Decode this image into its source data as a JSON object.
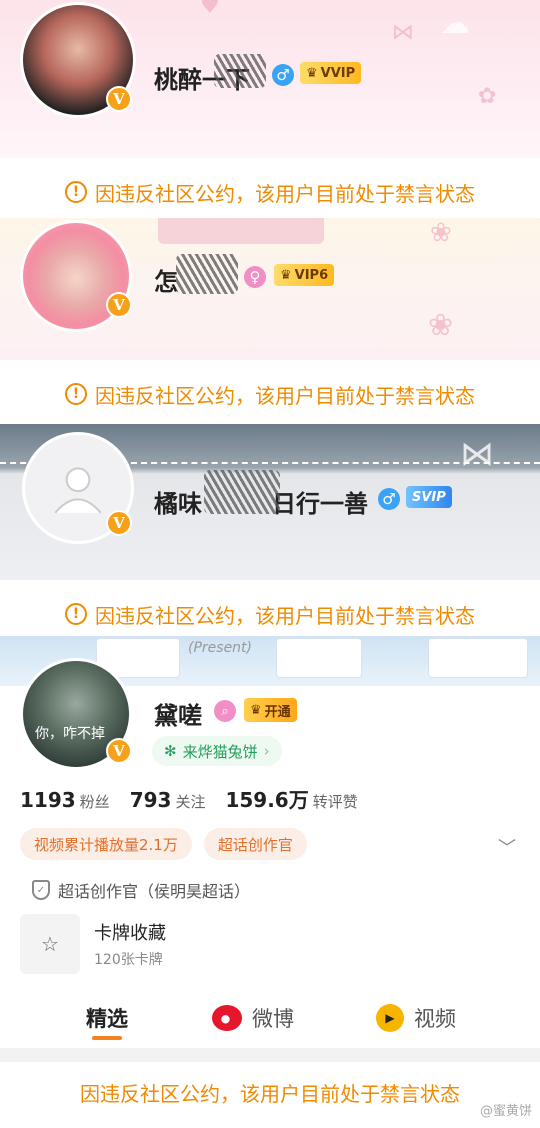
{
  "profiles": [
    {
      "name_visible": "桃醉一下",
      "gender_icon": "male-icon",
      "vip_label": "VVIP",
      "verified_badge": "V",
      "banned_notice": "因违反社区公约，该用户目前处于禁言状态"
    },
    {
      "name_visible": "怎",
      "gender_icon": "female-icon",
      "vip_label": "VIP6",
      "verified_badge": "V",
      "banned_notice": "因违反社区公约，该用户目前处于禁言状态"
    },
    {
      "name_visible": "橘味",
      "name_visible_suffix": "日行一善",
      "gender_icon": "male-icon",
      "vip_label": "SVIP",
      "verified_badge": "V",
      "banned_notice": "因违反社区公约，该用户目前处于禁言状态"
    }
  ],
  "main_profile": {
    "banner_text": "(Present)",
    "avatar_caption": "你，咋不掉",
    "name": "黛嗟",
    "verified_badge": "V",
    "open_label": "开通",
    "sponsor_label": "来烨猫兔饼",
    "stats": [
      {
        "value": "1193",
        "label": "粉丝"
      },
      {
        "value": "793",
        "label": "关注"
      },
      {
        "value": "159.6万",
        "label": "转评赞"
      }
    ],
    "tags": [
      "视频累计播放量2.1万",
      "超话创作官"
    ],
    "cert_text": "超话创作官（侯明昊超话）",
    "card": {
      "title": "卡牌收藏",
      "subtitle": "120张卡牌"
    },
    "tabs": [
      "精选",
      "微博",
      "视频"
    ],
    "banned_notice": "因违反社区公约，该用户目前处于禁言状态"
  },
  "watermark": "@蜜黄饼"
}
